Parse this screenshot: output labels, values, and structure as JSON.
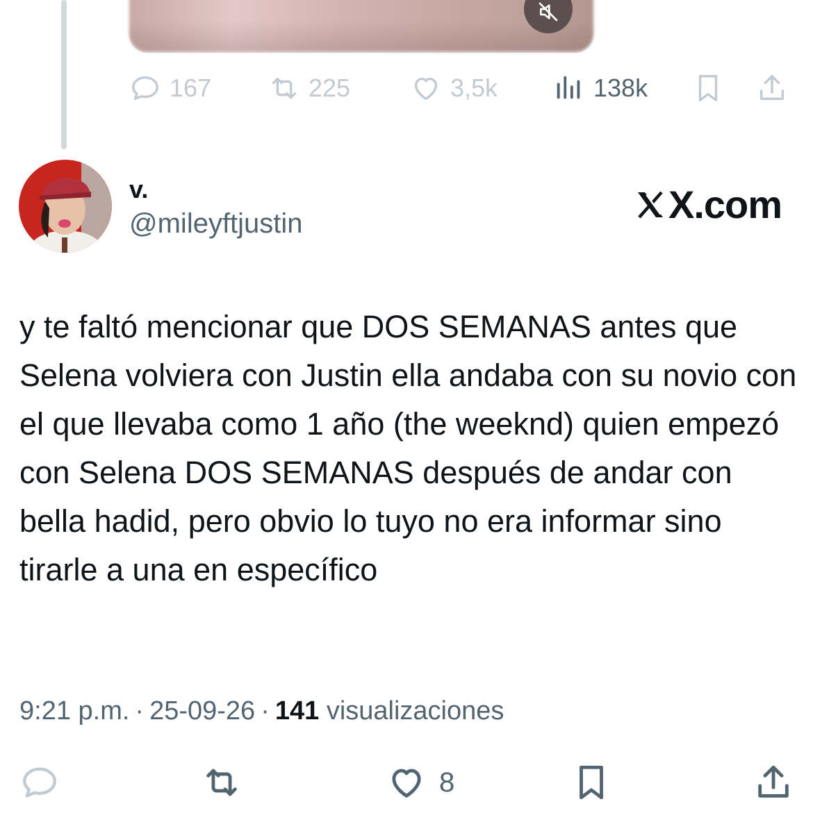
{
  "prev_tweet": {
    "stats": {
      "replies": "167",
      "reposts": "225",
      "likes": "3,5k",
      "views": "138k"
    }
  },
  "tweet": {
    "author_name": "v.",
    "author_handle": "@mileyftjustin",
    "watermark": "X.com",
    "text": "y te faltó mencionar que DOS SEMANAS antes que Selena volviera con Justin ella andaba con su novio con el que llevaba como 1 año (the weeknd) quien empezó con Selena DOS SEMANAS después de andar con bella hadid, pero obvio lo tuyo no era informar sino tirarle a una en específico",
    "time": "9:21 p.m.",
    "date": "25-09-26",
    "views_count": "141",
    "views_label": "visualizaciones",
    "likes": "8"
  },
  "icons": {
    "reply": "comment-icon",
    "repost": "repost-icon",
    "like": "heart-icon",
    "views": "views-chart-icon",
    "bookmark": "bookmark-icon",
    "share": "share-icon",
    "mute": "mute-icon"
  },
  "colors": {
    "muted_text": "#536471",
    "faded_icon": "#c2cbd2",
    "thread_line": "#cfd9de"
  }
}
